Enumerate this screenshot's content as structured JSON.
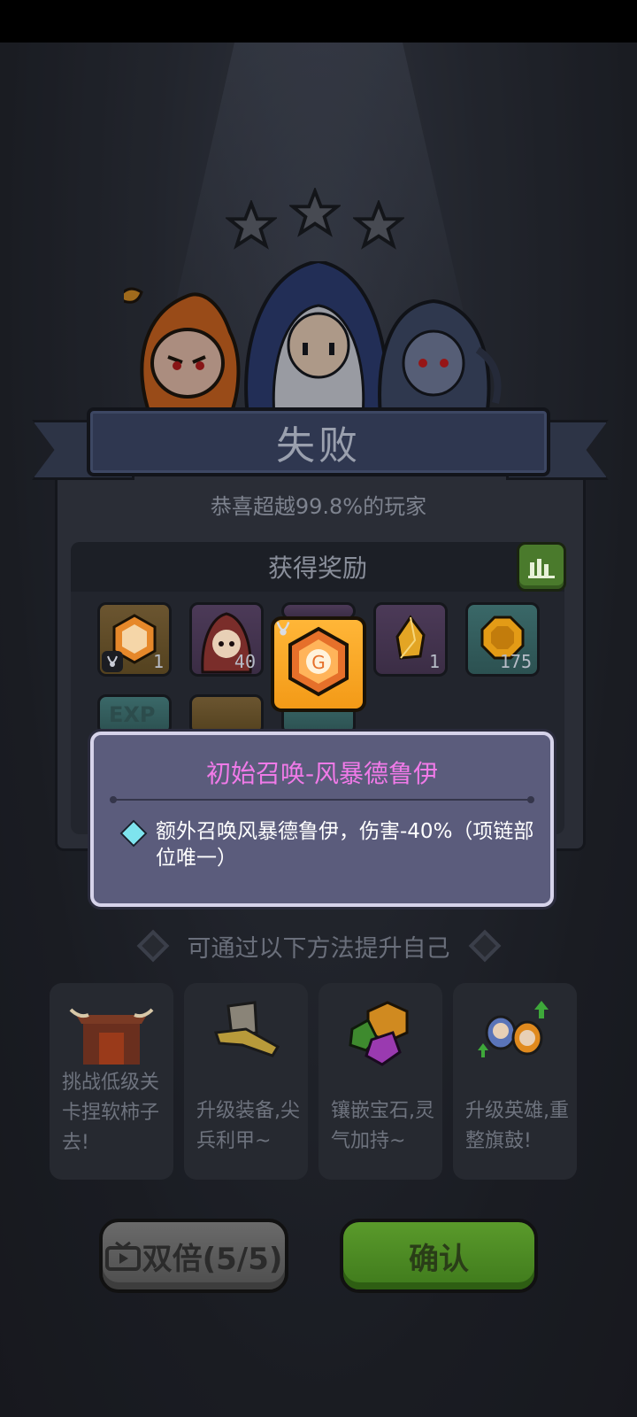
{
  "result": {
    "title": "失败",
    "subtitle": "恭喜超越99.8%的玩家"
  },
  "rewards": {
    "header": "获得奖励",
    "items": [
      {
        "name": "hexagon-relic",
        "count": "1",
        "color": "orange"
      },
      {
        "name": "hooded-hero",
        "count": "40",
        "color": "purple"
      },
      {
        "name": "gold-crystal",
        "count": "1",
        "color": "purple"
      },
      {
        "name": "gold-coin",
        "count": "175",
        "color": "teal"
      }
    ],
    "second_row_partial": [
      "EXP"
    ]
  },
  "tooltip": {
    "title": "初始召唤-风暴德鲁伊",
    "description": "额外召唤风暴德鲁伊，伤害-40%（项链部位唯一）"
  },
  "improve": {
    "title": "可通过以下方法提升自己",
    "options": [
      {
        "label": "挑战低级关卡捏软柿子去!"
      },
      {
        "label": "升级装备,尖兵利甲~"
      },
      {
        "label": "镶嵌宝石,灵气加持~"
      },
      {
        "label": "升级英雄,重整旗鼓!"
      }
    ]
  },
  "buttons": {
    "double": "双倍(5/5)",
    "confirm": "确认"
  },
  "colors": {
    "tooltip_title": "#f07ae8",
    "confirm_green": "#4f8a24",
    "selected_slot": "#f7a52a"
  }
}
